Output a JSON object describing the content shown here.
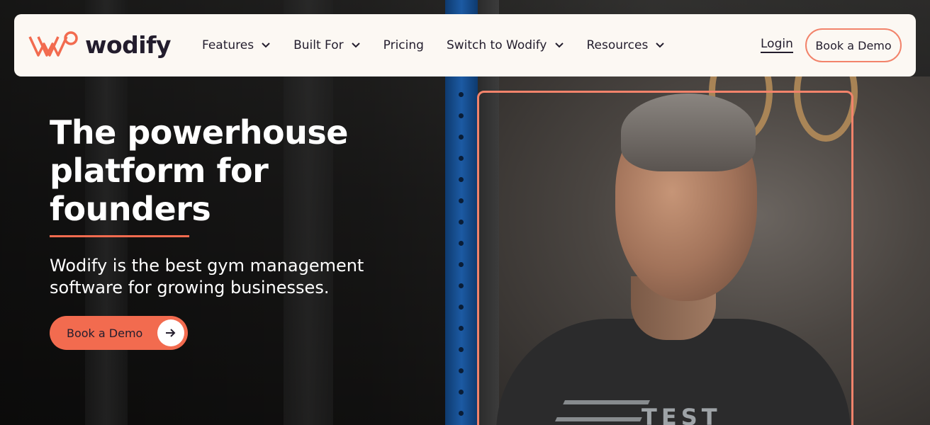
{
  "brand": {
    "name": "wodify",
    "accent": "#f26b4f",
    "ink": "#231d2d"
  },
  "nav": {
    "items": [
      {
        "label": "Features",
        "has_dropdown": true
      },
      {
        "label": "Built For",
        "has_dropdown": true
      },
      {
        "label": "Pricing",
        "has_dropdown": false
      },
      {
        "label": "Switch to Wodify",
        "has_dropdown": true
      },
      {
        "label": "Resources",
        "has_dropdown": true
      }
    ],
    "login_label": "Login",
    "demo_label": "Book a Demo"
  },
  "hero": {
    "title_lines": [
      "The powerhouse",
      "platform for",
      "founders"
    ],
    "subtitle": "Wodify is the best gym management software for growing businesses.",
    "cta_label": "Book a Demo",
    "cta_icon": "arrow-right-icon"
  },
  "video": {
    "shirt_text": "TEST"
  }
}
